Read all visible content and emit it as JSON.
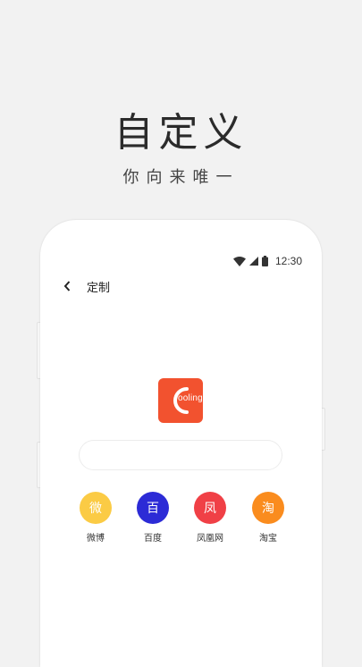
{
  "hero": {
    "title": "自定义",
    "subtitle": "你向来唯一"
  },
  "status_bar": {
    "time": "12:30",
    "icons": [
      "wifi-icon",
      "signal-icon",
      "battery-icon"
    ]
  },
  "app_bar": {
    "back_icon": "chevron-left-icon",
    "title": "定制"
  },
  "logo": {
    "text": "ooling",
    "color": "#f2522f"
  },
  "search": {
    "value": "",
    "placeholder": ""
  },
  "shortcuts": [
    {
      "glyph": "微",
      "label": "微博",
      "color": "#fbcb45"
    },
    {
      "glyph": "百",
      "label": "百度",
      "color": "#2c2bd6"
    },
    {
      "glyph": "凤",
      "label": "凤凰网",
      "color": "#f04046"
    },
    {
      "glyph": "淘",
      "label": "淘宝",
      "color": "#fa8c1e"
    }
  ]
}
